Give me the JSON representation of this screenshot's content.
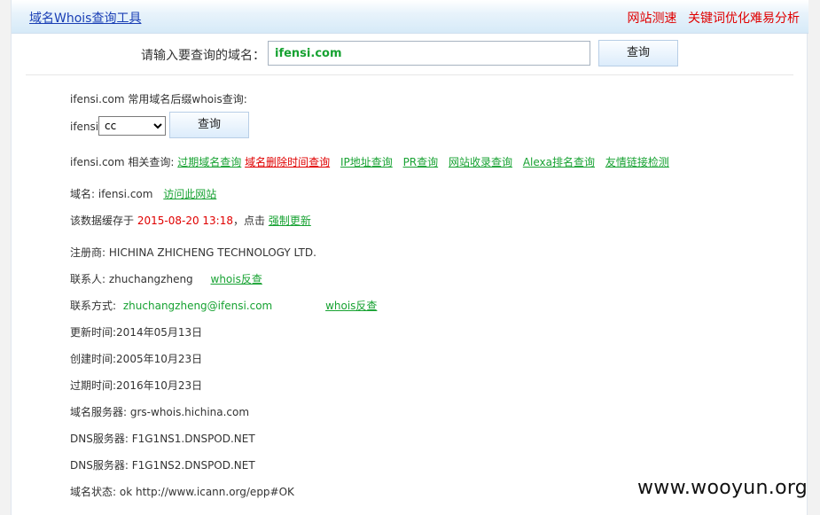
{
  "header": {
    "title": "域名Whois查询工具",
    "links": [
      "网站测速",
      "关键词优化难易分析"
    ]
  },
  "query": {
    "label": "请输入要查询的域名：",
    "value": "ifensi.com",
    "button": "查询"
  },
  "suffix_query": {
    "heading": "ifensi.com 常用域名后缀whois查询:",
    "prefix": "ifensi.",
    "selected": "cc",
    "button": "查询"
  },
  "related": {
    "label": "ifensi.com 相关查询:",
    "links": [
      {
        "text": "过期域名查询",
        "color": "#17a232"
      },
      {
        "text": "域名删除时间查询",
        "color": "#e00000"
      },
      {
        "text": "IP地址查询",
        "color": "#17a232"
      },
      {
        "text": "PR查询",
        "color": "#17a232"
      },
      {
        "text": "网站收录查询",
        "color": "#17a232"
      },
      {
        "text": "Alexa排名查询",
        "color": "#17a232"
      },
      {
        "text": "友情链接检测",
        "color": "#17a232"
      }
    ]
  },
  "domain_row": {
    "label": "域名:",
    "value": "ifensi.com",
    "link": "访问此网站"
  },
  "cache_row": {
    "prefix": "该数据缓存于",
    "time": "2015-08-20 13:18",
    "middle": "，点击",
    "link": "强制更新"
  },
  "registrar": {
    "label": "注册商:",
    "value": "HICHINA ZHICHENG TECHNOLOGY LTD."
  },
  "contact": {
    "label": "联系人:",
    "value": "zhuchangzheng",
    "link": "whois反查"
  },
  "contact_method": {
    "label": "联系方式:",
    "value": "zhuchangzheng@ifensi.com",
    "link": "whois反查"
  },
  "updated": {
    "label": "更新时间:",
    "value": "2014年05月13日"
  },
  "created": {
    "label": "创建时间:",
    "value": "2005年10月23日"
  },
  "expires": {
    "label": "过期时间:",
    "value": "2016年10月23日"
  },
  "whois_server": {
    "label": "域名服务器:",
    "value": "grs-whois.hichina.com"
  },
  "dns1": {
    "label": "DNS服务器:",
    "value": "F1G1NS1.DNSPOD.NET"
  },
  "dns2": {
    "label": "DNS服务器:",
    "value": "F1G1NS2.DNSPOD.NET"
  },
  "status": {
    "label": "域名状态:",
    "value": "ok http://www.icann.org/epp#OK"
  },
  "watermark": "www.wooyun.org"
}
